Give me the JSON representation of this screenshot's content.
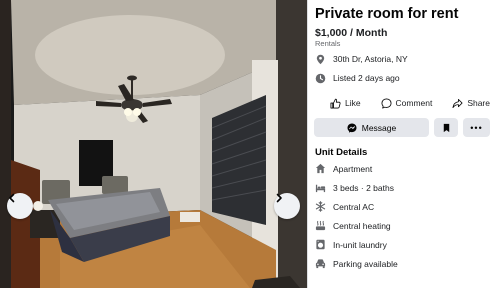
{
  "listing": {
    "title": "Private room for rent",
    "price": "$1,000 / Month",
    "category": "Rentals",
    "address": "30th Dr, Astoria, NY",
    "listed": "Listed 2 days ago"
  },
  "actions": {
    "like": "Like",
    "comment": "Comment",
    "share": "Share",
    "message": "Message"
  },
  "details": {
    "title": "Unit Details",
    "items": [
      {
        "label": "Apartment",
        "icon": "house-icon"
      },
      {
        "label": "3 beds · 2 baths",
        "icon": "bed-icon"
      },
      {
        "label": "Central AC",
        "icon": "snowflake-icon"
      },
      {
        "label": "Central heating",
        "icon": "heating-icon"
      },
      {
        "label": "In-unit laundry",
        "icon": "washer-icon"
      },
      {
        "label": "Parking available",
        "icon": "car-icon"
      }
    ]
  },
  "colors": {
    "button_bg": "#e4e6eb",
    "icon_gray": "#65676b"
  }
}
